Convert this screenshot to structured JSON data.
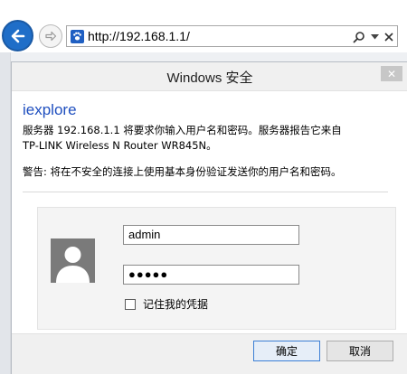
{
  "browser": {
    "url": "http://192.168.1.1/",
    "icons": {
      "back": "back-arrow-icon",
      "forward": "forward-arrow-icon",
      "favicon": "paw-icon",
      "search": "search-icon",
      "dropdown": "chevron-down-icon",
      "close": "close-icon"
    }
  },
  "dialog": {
    "title": "Windows 安全",
    "app_name": "iexplore",
    "message_line1": "服务器 192.168.1.1 将要求你输入用户名和密码。服务器报告它来自",
    "message_line2": "TP-LINK Wireless N Router WR845N。",
    "warning": "警告: 将在不安全的连接上使用基本身份验证发送你的用户名和密码。",
    "username_value": "admin",
    "password_mask": "●●●●●",
    "remember_label": "记住我的凭据",
    "remember_checked": false,
    "ok_label": "确定",
    "cancel_label": "取消",
    "close_glyph": "✕"
  },
  "colors": {
    "back_button": "#1f6ec8",
    "app_name": "#1f4fbf",
    "ok_button_border": "#3c7fd5"
  }
}
